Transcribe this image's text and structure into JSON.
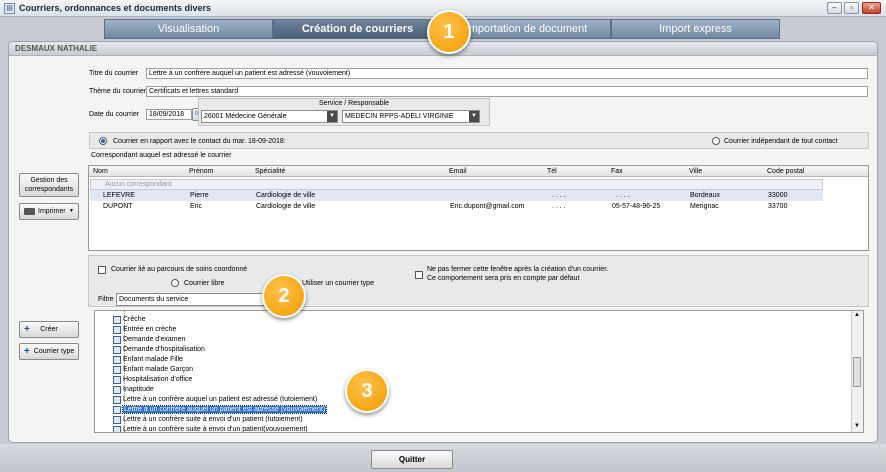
{
  "window": {
    "title": "Courriers, ordonnances et documents divers",
    "buttons": {
      "minimize": "–",
      "maximize": "▫",
      "close": "✕"
    }
  },
  "tabs": [
    {
      "label": "Visualisation",
      "active": false
    },
    {
      "label": "Création de courriers",
      "active": true
    },
    {
      "label": "Importation de document",
      "active": false
    },
    {
      "label": "Import express",
      "active": false
    }
  ],
  "patient": {
    "name": "DESMAUX NATHALIE"
  },
  "form": {
    "titre_label": "Titre du courrier",
    "titre_value": "Lettre à un confrère auquel un patient est adressé (vouvoiement)",
    "theme_label": "Thème du courrier",
    "theme_value": "Certificats et lettres standard",
    "date_label": "Date du courrier",
    "date_value": "18/09/2018",
    "date_btn": "01",
    "service_header": "Service  /  Responsable",
    "service_value": "26001 Médecine Générale",
    "responsable_value": "MEDECIN RPPS-ADELI VIRGINIE"
  },
  "contact_mode": {
    "option1": "Courrier en rapport avec le contact du mar. 18-09-2018:",
    "option2": "Courrier indépendant de tout contact"
  },
  "correspondants": {
    "heading": "Correspondant auquel est adressé le courrier",
    "columns": [
      "Nom",
      "Prénom",
      "Spécialité",
      "Email",
      "Tél",
      "Fax",
      "Ville",
      "Code postal"
    ],
    "none_label": "Aucun correspondant",
    "rows": [
      {
        "nom": "LEFEVRE",
        "prenom": "Pierre",
        "specialite": "Cardiologie de ville",
        "email": "",
        "tel": ". . . .",
        "fax": ". . . .",
        "ville": "Bordeaux",
        "cp": "33000"
      },
      {
        "nom": "DUPONT",
        "prenom": "Eric",
        "specialite": "Cardiologie de ville",
        "email": "Eric.dupont@gmail.com",
        "tel": ". . . .",
        "fax": "05-57-48-96-25",
        "ville": "Merignac",
        "cp": "33700"
      }
    ]
  },
  "left_buttons": {
    "gestion": "Gestion des correspondants",
    "imprimer": "Imprimer",
    "creer": "Créer",
    "courrier_type": "Courrier type"
  },
  "options": {
    "parcours": "Courrier lié au parcours de soins coordonné",
    "courrier_libre": "Courrier libre",
    "courrier_type": "Utiliser un courrier type",
    "ne_pas_fermer_1": "Ne pas fermer cette fenêtre après la création d'un courrier.",
    "ne_pas_fermer_2": "Ce comportement sera pris en compte par défaut",
    "filtre_label": "Filtre",
    "filtre_value": "Documents du service"
  },
  "tree_items": [
    "Crèche",
    "Entrée en crèche",
    "Demande d'examen",
    "Demande d'hospitalisation",
    "Enfant malade Fille",
    "Enfant malade Garçon",
    "Hospitalisation d'office",
    "Inaptitude",
    "Lettre à un confrère auquel un patient est adressé (tutoiement)",
    "Lettre à un confrère auquel un patient est adressé (vouvoiement)",
    "Lettre à un confrère suite à envoi d'un patient (tutoiement)",
    "Lettre à un confrère suite à envoi d'un patient(vouvoiement)"
  ],
  "selected_tree_index": 9,
  "callouts": [
    "1",
    "2",
    "3"
  ],
  "footer": {
    "quit": "Quitter"
  },
  "colors": {
    "accent": "#f29a00",
    "selection": "#2f6fd0",
    "tab_active": "#4d6079"
  }
}
